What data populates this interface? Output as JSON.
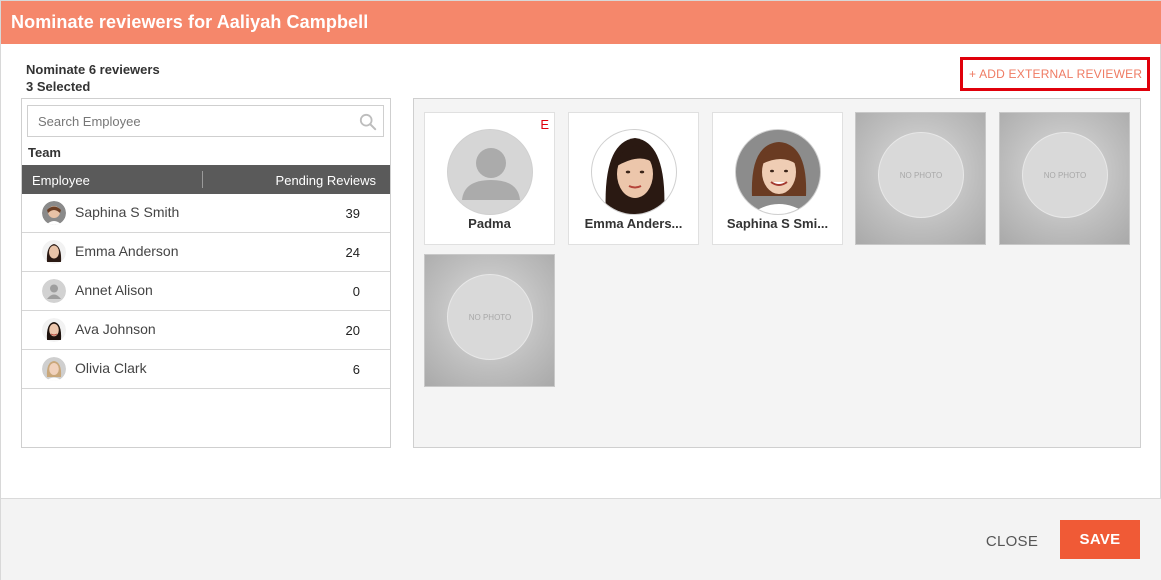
{
  "dialog": {
    "title": "Nominate reviewers for Aaliyah Campbell",
    "nominate_text": "Nominate 6 reviewers",
    "selected_text": "3 Selected",
    "add_external_label": "+ ADD EXTERNAL REVIEWER"
  },
  "search": {
    "placeholder": "Search Employee",
    "value": ""
  },
  "team": {
    "label": "Team",
    "columns": [
      "Employee",
      "Pending Reviews"
    ],
    "rows": [
      {
        "name": "Saphina S Smith",
        "pending": "39"
      },
      {
        "name": "Emma Anderson",
        "pending": "24"
      },
      {
        "name": "Annet Alison",
        "pending": "0"
      },
      {
        "name": "Ava Johnson",
        "pending": "20"
      },
      {
        "name": "Olivia Clark",
        "pending": "6"
      }
    ]
  },
  "selected_reviewers": {
    "cards": [
      {
        "name": "Padma",
        "tag": "E"
      },
      {
        "name": "Emma Anders..."
      },
      {
        "name": "Saphina S Smi..."
      }
    ],
    "empty_slot_text": "NO PHOTO"
  },
  "footer": {
    "close_label": "CLOSE",
    "save_label": "SAVE"
  },
  "colors": {
    "header": "#f5876b",
    "accent": "#f05a36",
    "highlight_border": "#e0000b"
  },
  "icons": {
    "search": "search-icon",
    "default_avatar": "user-silhouette-icon"
  }
}
